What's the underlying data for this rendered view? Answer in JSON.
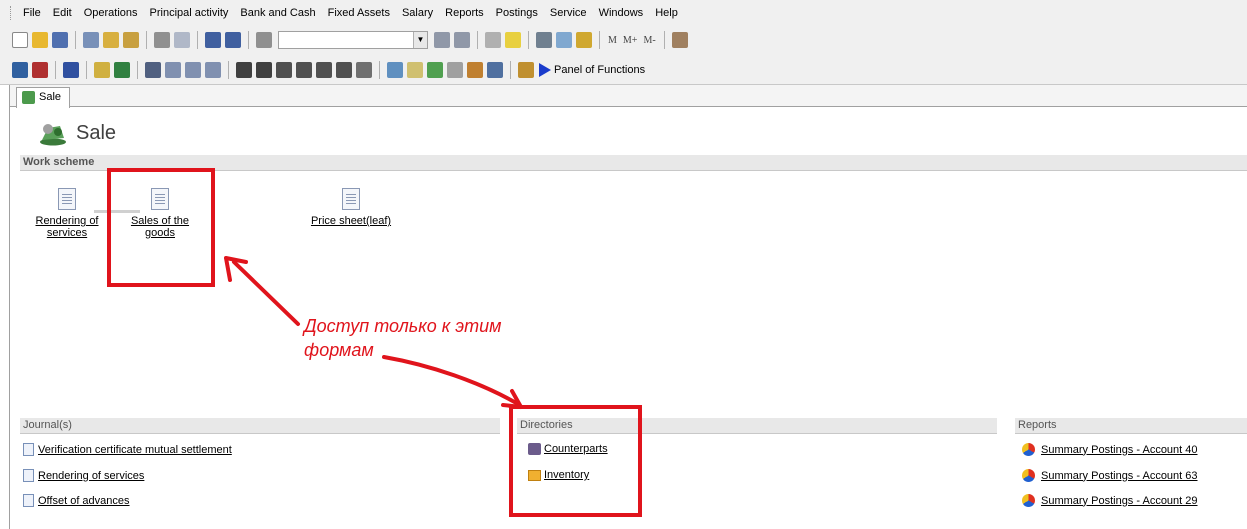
{
  "menu": [
    "File",
    "Edit",
    "Operations",
    "Principal activity",
    "Bank and Cash",
    "Fixed Assets",
    "Salary",
    "Reports",
    "Postings",
    "Service",
    "Windows",
    "Help"
  ],
  "toolbar": {
    "memory_labels": [
      "M",
      "M+",
      "M-"
    ],
    "panel_of_functions": "Panel of Functions"
  },
  "tab": {
    "label": "Sale"
  },
  "page": {
    "title": "Sale"
  },
  "work_scheme": {
    "header": "Work scheme",
    "items": [
      {
        "label_line1": "Rendering of",
        "label_line2": "services"
      },
      {
        "label_line1": "Sales of the",
        "label_line2": "goods"
      },
      {
        "label_line1": "Price sheet(leaf)",
        "label_line2": ""
      }
    ]
  },
  "journals": {
    "header": "Journal(s)",
    "items": [
      "Verification certificate mutual settlement",
      "Rendering of services",
      "Offset of advances"
    ]
  },
  "directories": {
    "header": "Directories",
    "items": [
      "Counterparts",
      "Inventory"
    ]
  },
  "reports": {
    "header": "Reports",
    "items": [
      "Summary Postings - Account 40",
      "Summary Postings - Account 63",
      "Summary Postings - Account 29"
    ]
  },
  "annotation": {
    "line1": "Доступ только к этим",
    "line2": "формам"
  },
  "colors": {
    "annotation_red": "#e0141c",
    "section_header_bg": "#e8e8e8",
    "toolbar_bg": "#f0f0f0"
  }
}
